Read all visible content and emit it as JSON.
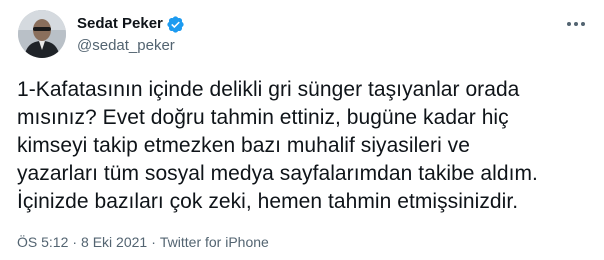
{
  "author": {
    "display_name": "Sedat Peker",
    "handle": "@sedat_peker",
    "verified": true
  },
  "tweet": {
    "lines": [
      "1-Kafatasının içinde delikli gri sünger taşıyanlar orada",
      "mısınız? Evet doğru tahmin ettiniz, bugüne kadar hiç",
      "kimseyi takip etmezken bazı muhalif siyasileri ve",
      "yazarları tüm sosyal medya sayfalarımdan takibe aldım.",
      "İçinizde bazıları çok zeki, hemen tahmin etmişsinizdir."
    ]
  },
  "meta": {
    "time": "ÖS 5:12",
    "separator": "·",
    "date": "8 Eki 2021",
    "source": "Twitter for iPhone"
  },
  "icons": {
    "verified": "verified-badge-icon",
    "more": "more-options-icon"
  },
  "colors": {
    "text": "#0f1419",
    "secondary": "#536471",
    "verified": "#1d9bf0"
  }
}
